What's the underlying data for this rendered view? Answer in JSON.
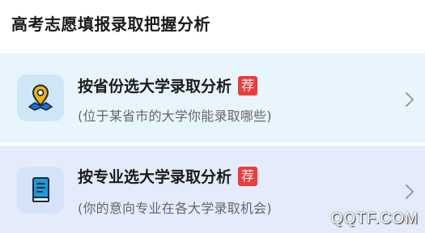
{
  "section": {
    "title": "高考志愿填报录取把握分析"
  },
  "cards": [
    {
      "title": "按省份选大学录取分析",
      "badge": "荐",
      "subtitle": "(位于某省市的大学你能录取哪些)",
      "icon": "map-location-pin-icon"
    },
    {
      "title": "按专业选大学录取分析",
      "badge": "荐",
      "subtitle": "(你的意向专业在各大学录取机会)",
      "icon": "book-icon"
    }
  ],
  "watermark": "QQTF.COM",
  "colors": {
    "card1_bg": "#e9f5fd",
    "card2_bg": "#e4ebfb",
    "badge": "#ee3b3b",
    "pin": "#f5b400",
    "book": "#1e9bd7"
  }
}
